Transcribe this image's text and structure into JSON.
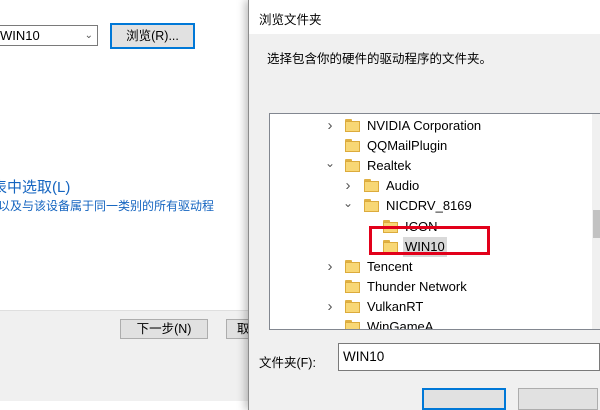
{
  "background_wizard": {
    "path_value": "WIN10",
    "browse_label": "浏览(R)...",
    "pick_title": "表中选取(L)",
    "pick_desc": "以及与该设备属于同一类别的所有驱动程",
    "next_label": "下一步(N)",
    "cancel_label": "取"
  },
  "dialog": {
    "title": "浏览文件夹",
    "instruction": "选择包含你的硬件的驱动程序的文件夹。",
    "tree_items": [
      {
        "label": "NVIDIA Corporation",
        "expander": "collapsed",
        "level": 0
      },
      {
        "label": "QQMailPlugin",
        "expander": "none",
        "level": 0
      },
      {
        "label": "Realtek",
        "expander": "expanded",
        "level": 0
      },
      {
        "label": "Audio",
        "expander": "collapsed",
        "level": 1
      },
      {
        "label": "NICDRV_8169",
        "expander": "expanded",
        "level": 1
      },
      {
        "label": "ICON",
        "expander": "none",
        "level": 2
      },
      {
        "label": "WIN10",
        "expander": "none",
        "level": 2,
        "selected": true
      },
      {
        "label": "Tencent",
        "expander": "collapsed",
        "level": 0
      },
      {
        "label": "Thunder Network",
        "expander": "none",
        "level": 0
      },
      {
        "label": "VulkanRT",
        "expander": "collapsed",
        "level": 0
      },
      {
        "label": "WinGameA...",
        "expander": "none",
        "level": 0
      }
    ],
    "folder_label": "文件夹(F):",
    "folder_value": "WIN10"
  },
  "colors": {
    "accent": "#0078d7",
    "link_text": "#1565c0",
    "highlight_annotation": "#e2001a",
    "folder_icon": "#f8d775"
  }
}
